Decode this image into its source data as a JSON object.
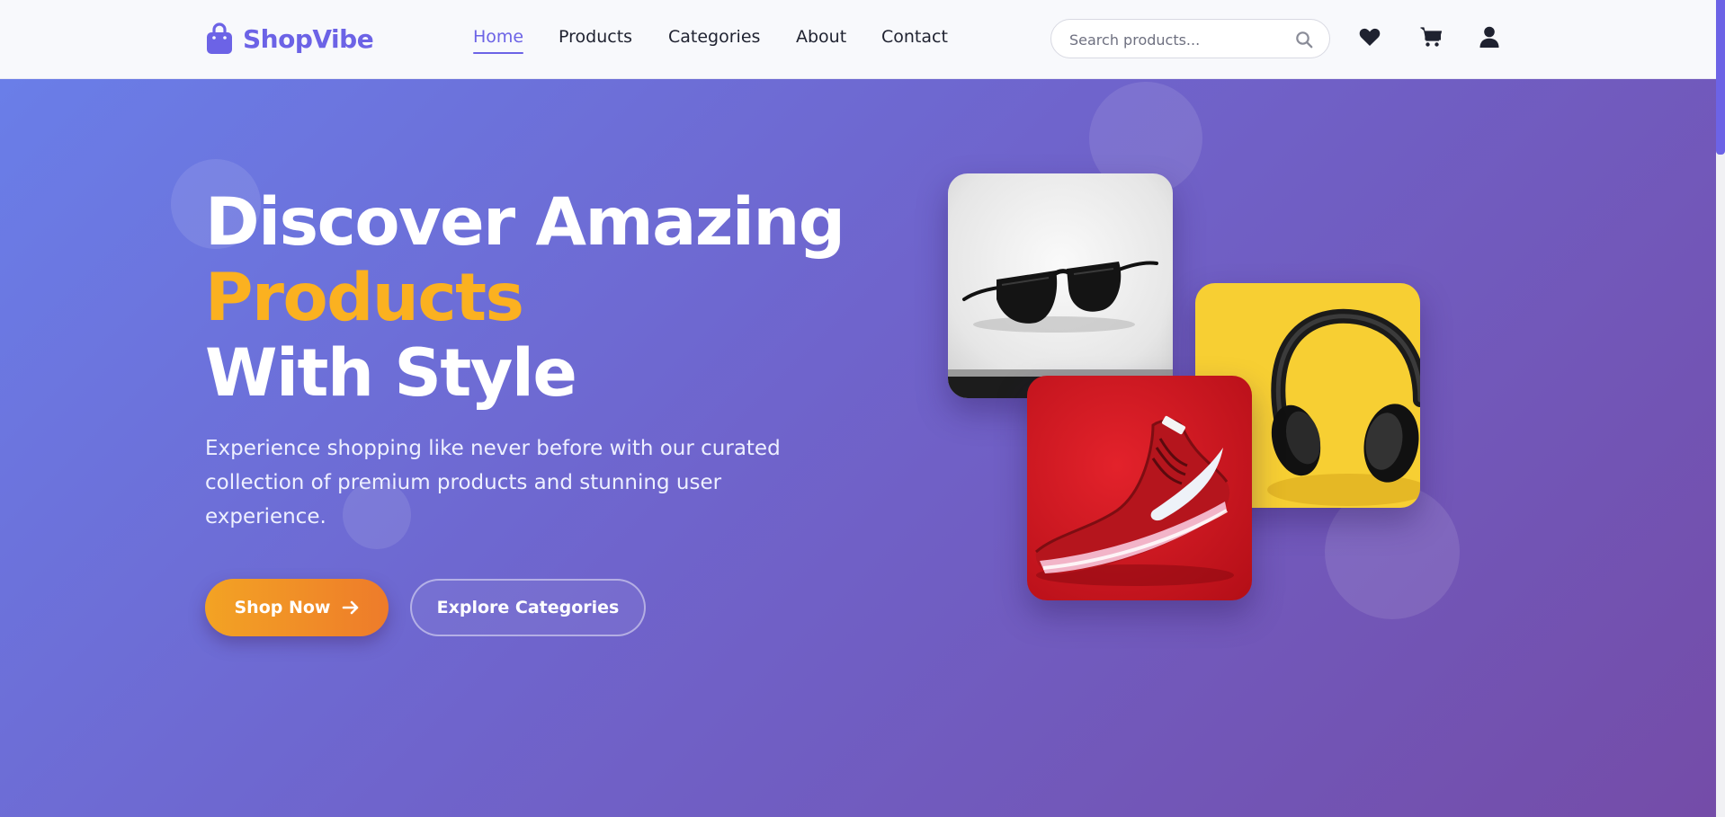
{
  "brand": {
    "name": "ShopVibe",
    "color": "#6c63e6",
    "icon": "shopping-bag-icon"
  },
  "nav": {
    "items": [
      {
        "label": "Home",
        "active": true
      },
      {
        "label": "Products",
        "active": false
      },
      {
        "label": "Categories",
        "active": false
      },
      {
        "label": "About",
        "active": false
      },
      {
        "label": "Contact",
        "active": false
      }
    ]
  },
  "search": {
    "placeholder": "Search products...",
    "value": "",
    "icon": "search-icon"
  },
  "header_icons": [
    "heart-icon",
    "cart-icon",
    "user-icon"
  ],
  "hero": {
    "headline_line1": "Discover Amazing",
    "headline_highlight": "Products",
    "headline_line3": "With Style",
    "subtitle": "Experience shopping like never before with our curated collection of premium products and stunning user experience.",
    "primary_button": "Shop Now",
    "secondary_button": "Explore Categories",
    "highlight_color": "#fbb120",
    "gradient": [
      "#6a7ee8",
      "#744ca8"
    ]
  },
  "product_images": [
    "sunglasses",
    "headphones",
    "red sneaker"
  ]
}
